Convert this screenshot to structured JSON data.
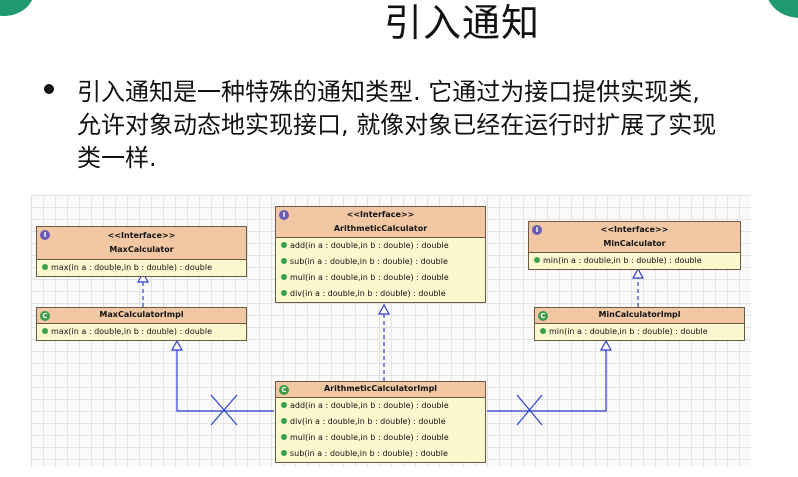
{
  "slide": {
    "title": "引入通知",
    "bullet": "引入通知是一种特殊的通知类型. 它通过为接口提供实现类, 允许对象动态地实现接口, 就像对象已经在运行时扩展了实现类一样."
  },
  "diagram": {
    "interface_glyph": "I",
    "class_glyph": "C",
    "stereotype": "<<Interface>>",
    "max_interface": {
      "name": "MaxCalculator",
      "methods": [
        "max(in a : double,in b : double) : double"
      ]
    },
    "arith_interface": {
      "name": "ArithmeticCalculator",
      "methods": [
        "add(in a : double,in b : double) : double",
        "sub(in a : double,in b : double) : double",
        "mul(in a : double,in b : double) : double",
        "div(in a : double,in b : double) : double"
      ]
    },
    "min_interface": {
      "name": "MinCalculator",
      "methods": [
        "min(in a : double,in b : double) : double"
      ]
    },
    "max_impl": {
      "name": "MaxCalculatorImpl",
      "methods": [
        "max(in a : double,in b : double) : double"
      ]
    },
    "min_impl": {
      "name": "MinCalculatorImpl",
      "methods": [
        "min(in a : double,in b : double) : double"
      ]
    },
    "arith_impl": {
      "name": "ArithmeticCalculatorImpl",
      "methods": [
        "add(in a : double,in b : double) : double",
        "div(in a : double,in b : double) : double",
        "mul(in a : double,in b : double) : double",
        "sub(in a : double,in b : double) : double"
      ]
    },
    "colors": {
      "header": "#f2c7a4",
      "body": "#fbf7cf",
      "border": "#6b5a44",
      "connector": "#2b3fd1",
      "grid": "#e3e3e3"
    }
  }
}
